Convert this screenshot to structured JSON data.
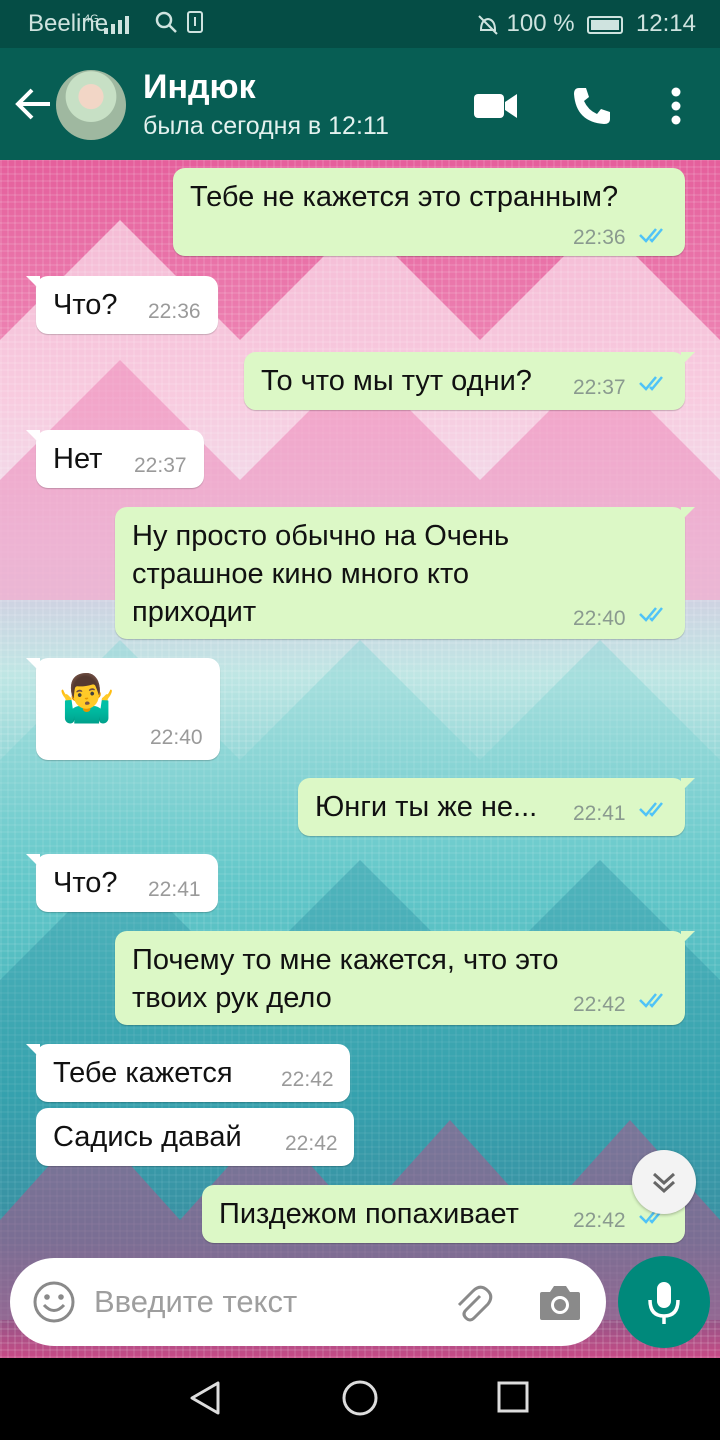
{
  "status_bar": {
    "carrier": "Beeline",
    "network": "4G",
    "battery": "100 %",
    "time": "12:14"
  },
  "header": {
    "contact_name": "Индюк",
    "last_seen": "была сегодня в 12:11",
    "icons": [
      "back-arrow-icon",
      "video-call-icon",
      "phone-icon",
      "more-vert-icon"
    ]
  },
  "messages": [
    {
      "dir": "out",
      "text": "Тебе не кажется это странным?",
      "time": "22:36",
      "read": true
    },
    {
      "dir": "in",
      "text": "Что?",
      "time": "22:36"
    },
    {
      "dir": "out",
      "text": "То что мы тут одни?",
      "time": "22:37",
      "read": true
    },
    {
      "dir": "in",
      "text": "Нет",
      "time": "22:37"
    },
    {
      "dir": "out",
      "lines": [
        "Ну просто обычно на Очень",
        "страшное  кино много кто",
        "приходит"
      ],
      "time": "22:40",
      "read": true
    },
    {
      "dir": "in",
      "emoji": "🤷‍♂️",
      "time": "22:40"
    },
    {
      "dir": "out",
      "text": "Юнги ты же не...",
      "time": "22:41",
      "read": true
    },
    {
      "dir": "in",
      "text": "Что?",
      "time": "22:41"
    },
    {
      "dir": "out",
      "lines": [
        "Почему то мне кажется, что это",
        "твоих рук дело"
      ],
      "time": "22:42",
      "read": true
    },
    {
      "dir": "in",
      "text": "Тебе кажется",
      "time": "22:42"
    },
    {
      "dir": "in",
      "text": "Садись давай",
      "time": "22:42"
    },
    {
      "dir": "out",
      "text": "Пиздежом попахивает",
      "time": "22:42",
      "read": true
    }
  ],
  "composer": {
    "placeholder": "Введите текст",
    "value": ""
  },
  "colors": {
    "header": "#075e54",
    "outgoing_bubble": "#dcf8c6",
    "incoming_bubble": "#ffffff",
    "read_ticks": "#4fc3f7",
    "mic_button": "#00897b"
  }
}
